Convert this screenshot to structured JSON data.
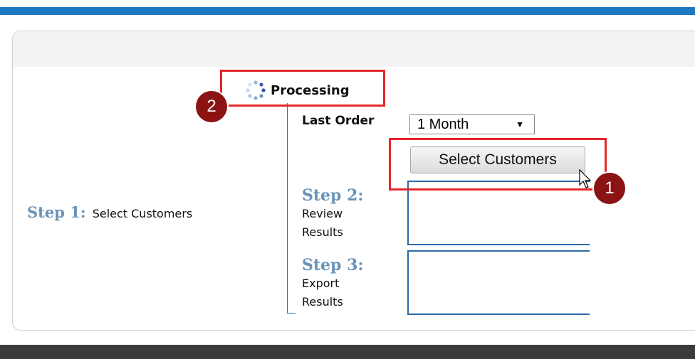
{
  "processing": {
    "label": "Processing",
    "icon": "spinner-icon"
  },
  "filter": {
    "last_order_label": "Last Order",
    "last_order_value": "1 Month"
  },
  "select_customers_button": "Select Customers",
  "steps": [
    {
      "title": "Step 1:",
      "desc": "Select Customers"
    },
    {
      "title": "Step 2:",
      "desc_line1": "Review",
      "desc_line2": "Results"
    },
    {
      "title": "Step 3:",
      "desc_line1": "Export",
      "desc_line2": "Results"
    }
  ],
  "annotations": {
    "badge_processing": "2",
    "badge_button": "1"
  },
  "colors": {
    "top_bar": "#1f79c1",
    "step_title": "#6a93b8",
    "highlight": "#e4262b",
    "badge": "#8b1313",
    "footer": "#3b3b3b"
  }
}
